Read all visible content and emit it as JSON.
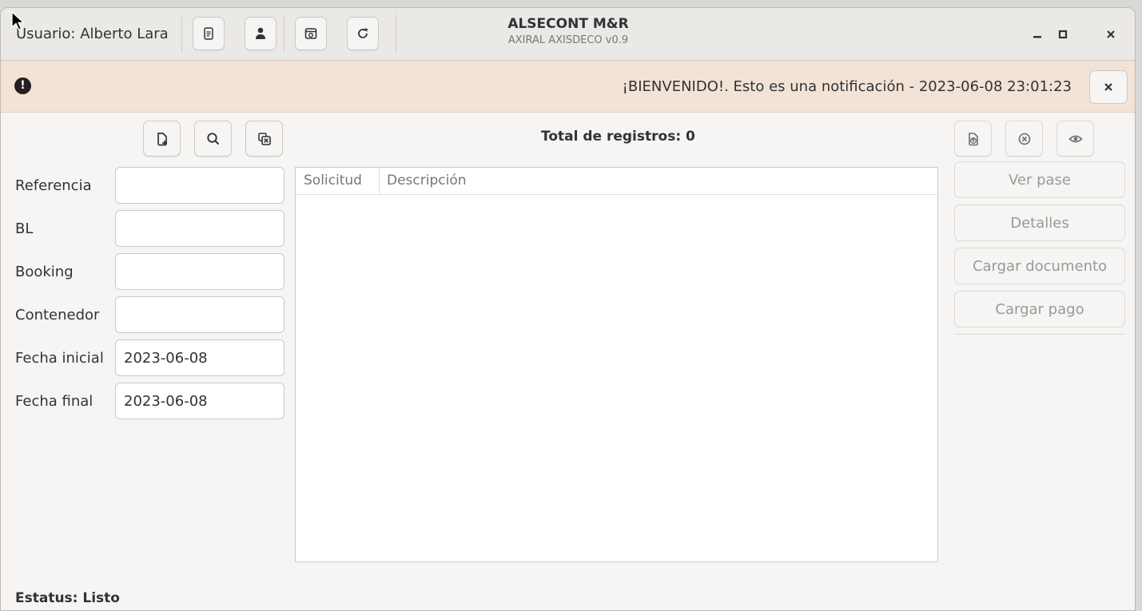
{
  "header": {
    "user_label": "Usuario: Alberto Lara",
    "title": "ALSECONT M&R",
    "subtitle": "AXIRAL AXISDECO v0.9",
    "buttons": [
      "document-icon",
      "user-icon",
      "package-icon",
      "refresh-icon"
    ],
    "window_controls": {
      "minimize": "–",
      "maximize": "▫",
      "close": "✕"
    }
  },
  "notification": {
    "text": "¡BIENVENIDO!. Esto es una notificación - 2023-06-08 23:01:23",
    "close": "✕",
    "icon": "!"
  },
  "toolbar": {
    "left_buttons": [
      "new-document-icon",
      "search-icon",
      "clear-icon"
    ],
    "right_buttons": [
      "upload-icon",
      "cancel-icon",
      "view-icon"
    ]
  },
  "total_label": "Total de registros: 0",
  "form": {
    "referencia_label": "Referencia",
    "referencia_value": "",
    "bl_label": "BL",
    "bl_value": "",
    "booking_label": "Booking",
    "booking_value": "",
    "contenedor_label": "Contenedor",
    "contenedor_value": "",
    "fecha_inicial_label": "Fecha inicial",
    "fecha_inicial_value": "2023-06-08",
    "fecha_final_label": "Fecha final",
    "fecha_final_value": "2023-06-08"
  },
  "table": {
    "columns": [
      "Solicitud",
      "Descripción"
    ],
    "rows": []
  },
  "side_buttons": {
    "ver_pase": "Ver pase",
    "detalles": "Detalles",
    "cargar_documento": "Cargar documento",
    "cargar_pago": "Cargar pago"
  },
  "status": "Estatus: Listo"
}
